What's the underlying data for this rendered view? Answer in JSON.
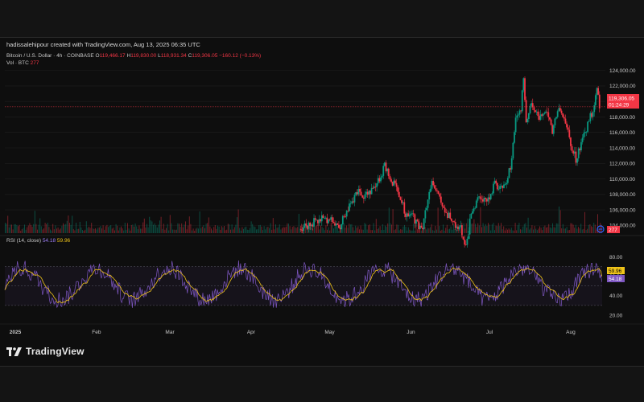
{
  "header": {
    "attribution": "hadissalehipour created with TradingView.com, Aug 13, 2025 06:35 UTC"
  },
  "legend": {
    "symbol": "Bitcoin / U.S. Dollar · 4h · COINBASE",
    "open_label": "O",
    "open": "119,466.17",
    "high_label": "H",
    "high": "119,830.00",
    "low_label": "L",
    "low": "118,931.34",
    "close_label": "C",
    "close": "119,306.05",
    "change": "−160.12 (−0.13%)",
    "volume_label": "Vol · BTC",
    "volume_value": "277",
    "rsi_label": "RSI (14, close)",
    "rsi_value": "54.18",
    "rsi_ma_value": "59.96"
  },
  "badges": {
    "price": "119,306.05",
    "countdown": "01:24:29",
    "volume": "277",
    "rsi_ma": "59.96",
    "rsi": "54.18"
  },
  "logo": {
    "text": "TradingView"
  },
  "colors": {
    "up": "#089981",
    "down": "#f23645",
    "rsi": "#7e57c2",
    "rsi_ma": "#f0c419"
  },
  "chart_data": [
    {
      "type": "candlestick",
      "title": "Bitcoin / U.S. Dollar · 4h · COINBASE",
      "price_axis_ticks": [
        104000,
        106000,
        108000,
        110000,
        112000,
        114000,
        116000,
        118000,
        120000,
        122000,
        124000
      ],
      "ylim": [
        103000,
        125000
      ],
      "x_tick_labels": [
        "2025",
        "Feb",
        "Mar",
        "Apr",
        "May",
        "Jun",
        "Jul",
        "Aug"
      ],
      "x_tick_dates": [
        "2025-01-01",
        "2025-02-01",
        "2025-03-01",
        "2025-04-01",
        "2025-05-01",
        "2025-06-01",
        "2025-07-01",
        "2025-08-01"
      ],
      "visible_range": [
        "2024-12-28",
        "2025-08-13"
      ],
      "approx_close_path": [
        {
          "date": "2025-04-20",
          "close": 103500
        },
        {
          "date": "2025-04-28",
          "close": 105000
        },
        {
          "date": "2025-05-05",
          "close": 104000
        },
        {
          "date": "2025-05-08",
          "close": 106000
        },
        {
          "date": "2025-05-12",
          "close": 108500
        },
        {
          "date": "2025-05-14",
          "close": 107500
        },
        {
          "date": "2025-05-18",
          "close": 109000
        },
        {
          "date": "2025-05-21",
          "close": 110500
        },
        {
          "date": "2025-05-22",
          "close": 111800
        },
        {
          "date": "2025-05-25",
          "close": 109500
        },
        {
          "date": "2025-05-27",
          "close": 108500
        },
        {
          "date": "2025-05-30",
          "close": 105500
        },
        {
          "date": "2025-06-02",
          "close": 105000
        },
        {
          "date": "2025-06-05",
          "close": 103200
        },
        {
          "date": "2025-06-09",
          "close": 109500
        },
        {
          "date": "2025-06-12",
          "close": 107500
        },
        {
          "date": "2025-06-15",
          "close": 105500
        },
        {
          "date": "2025-06-18",
          "close": 104000
        },
        {
          "date": "2025-06-20",
          "close": 103500
        },
        {
          "date": "2025-06-22",
          "close": 101000
        },
        {
          "date": "2025-06-24",
          "close": 105500
        },
        {
          "date": "2025-06-27",
          "close": 107500
        },
        {
          "date": "2025-06-30",
          "close": 107000
        },
        {
          "date": "2025-07-03",
          "close": 109500
        },
        {
          "date": "2025-07-06",
          "close": 108500
        },
        {
          "date": "2025-07-09",
          "close": 111500
        },
        {
          "date": "2025-07-11",
          "close": 117500
        },
        {
          "date": "2025-07-13",
          "close": 119000
        },
        {
          "date": "2025-07-14",
          "close": 122800
        },
        {
          "date": "2025-07-15",
          "close": 117000
        },
        {
          "date": "2025-07-17",
          "close": 119500
        },
        {
          "date": "2025-07-20",
          "close": 118000
        },
        {
          "date": "2025-07-23",
          "close": 119000
        },
        {
          "date": "2025-07-25",
          "close": 116000
        },
        {
          "date": "2025-07-27",
          "close": 119000
        },
        {
          "date": "2025-07-29",
          "close": 118500
        },
        {
          "date": "2025-08-01",
          "close": 114500
        },
        {
          "date": "2025-08-03",
          "close": 112500
        },
        {
          "date": "2025-08-05",
          "close": 114500
        },
        {
          "date": "2025-08-07",
          "close": 116500
        },
        {
          "date": "2025-08-08",
          "close": 117500
        },
        {
          "date": "2025-08-09",
          "close": 118500
        },
        {
          "date": "2025-08-10",
          "close": 119500
        },
        {
          "date": "2025-08-11",
          "close": 121500
        },
        {
          "date": "2025-08-12",
          "close": 119300
        }
      ],
      "last_price": 119306.05
    },
    {
      "type": "line",
      "title": "RSI (14, close)",
      "ylim": [
        15,
        92
      ],
      "y_ticks": [
        20,
        40,
        60,
        80
      ],
      "bands": [
        30,
        50,
        70
      ],
      "series": [
        {
          "name": "RSI",
          "last": 54.18
        },
        {
          "name": "RSI MA",
          "last": 59.96
        }
      ]
    }
  ]
}
